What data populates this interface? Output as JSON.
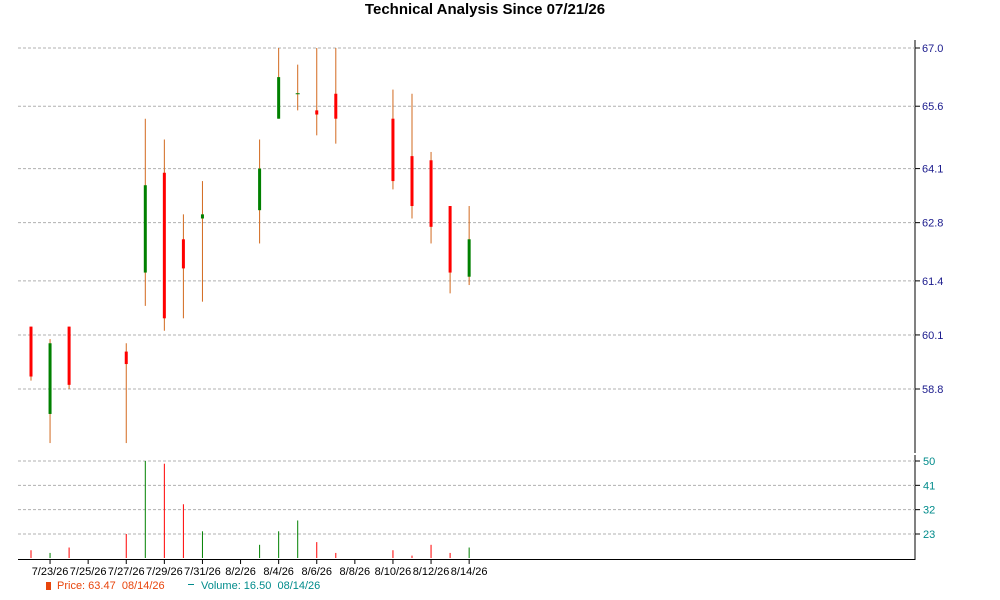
{
  "colors": {
    "up": "#008000",
    "down": "#ff0000",
    "wick": "#d2691e",
    "price_axis_text": "#1a1a8c",
    "volume_axis_text": "#008b8b",
    "grid": "#b0b0b0",
    "legend_price": "#e8450c",
    "legend_volume": "#008b8b"
  },
  "chart_data": {
    "type": "candlestick",
    "title": "Technical Analysis Since 07/21/26",
    "grid": true,
    "price_axis": {
      "position": "right",
      "ticks": [
        "67.0",
        "65.6",
        "64.1",
        "62.8",
        "61.4",
        "60.1",
        "58.8"
      ],
      "tick_values": [
        67.0,
        65.6,
        64.1,
        62.8,
        61.4,
        60.1,
        58.8
      ],
      "range": [
        57.4,
        67.0
      ]
    },
    "volume_axis": {
      "position": "right",
      "ticks": [
        "50",
        "41",
        "32",
        "23"
      ],
      "tick_values": [
        50,
        41,
        32,
        23
      ],
      "range": [
        15,
        50
      ]
    },
    "x_axis_labels": [
      "7/23/26",
      "7/25/26",
      "7/27/26",
      "7/29/26",
      "7/31/26",
      "8/2/26",
      "8/4/26",
      "8/6/26",
      "8/8/26",
      "8/10/26",
      "8/12/26",
      "8/14/26"
    ],
    "candles": [
      {
        "date": "7/22/26",
        "open": 60.3,
        "high": 60.3,
        "low": 59.0,
        "close": 59.1,
        "volume": 17
      },
      {
        "date": "7/23/26",
        "open": 58.2,
        "high": 60.0,
        "low": 57.5,
        "close": 59.9,
        "volume": 16
      },
      {
        "date": "7/24/26",
        "open": 60.3,
        "high": 60.3,
        "low": 58.8,
        "close": 58.9,
        "volume": 18
      },
      {
        "date": "7/27/26",
        "open": 59.7,
        "high": 59.9,
        "low": 57.5,
        "close": 59.4,
        "volume": 23
      },
      {
        "date": "7/28/26",
        "open": 61.6,
        "high": 65.3,
        "low": 60.8,
        "close": 63.7,
        "volume": 50
      },
      {
        "date": "7/29/26",
        "open": 64.0,
        "high": 64.8,
        "low": 60.2,
        "close": 60.5,
        "volume": 49
      },
      {
        "date": "7/30/26",
        "open": 62.4,
        "high": 63.0,
        "low": 60.5,
        "close": 61.7,
        "volume": 34
      },
      {
        "date": "7/31/26",
        "open": 62.9,
        "high": 63.8,
        "low": 60.9,
        "close": 63.0,
        "volume": 24
      },
      {
        "date": "8/3/26",
        "open": 63.1,
        "high": 64.8,
        "low": 62.3,
        "close": 64.1,
        "volume": 19
      },
      {
        "date": "8/4/26",
        "open": 65.3,
        "high": 67.0,
        "low": 65.3,
        "close": 66.3,
        "volume": 24
      },
      {
        "date": "8/5/26",
        "open": 65.9,
        "high": 66.6,
        "low": 65.5,
        "close": 65.9,
        "volume": 28
      },
      {
        "date": "8/6/26",
        "open": 65.5,
        "high": 67.0,
        "low": 64.9,
        "close": 65.4,
        "volume": 20
      },
      {
        "date": "8/7/26",
        "open": 65.9,
        "high": 67.0,
        "low": 64.7,
        "close": 65.3,
        "volume": 16
      },
      {
        "date": "8/10/26",
        "open": 65.3,
        "high": 66.0,
        "low": 63.6,
        "close": 63.8,
        "volume": 17
      },
      {
        "date": "8/11/26",
        "open": 64.4,
        "high": 65.9,
        "low": 62.9,
        "close": 63.2,
        "volume": 15
      },
      {
        "date": "8/12/26",
        "open": 64.3,
        "high": 64.5,
        "low": 62.3,
        "close": 62.7,
        "volume": 19
      },
      {
        "date": "8/13/26",
        "open": 63.2,
        "high": 63.2,
        "low": 61.1,
        "close": 61.6,
        "volume": 16
      },
      {
        "date": "8/14/26",
        "open": 61.5,
        "high": 63.2,
        "low": 61.3,
        "close": 62.4,
        "volume": 18
      }
    ]
  },
  "legend": {
    "price_label": "Price: 63.47",
    "price_date": "08/14/26",
    "volume_label": "Volume: 16.50",
    "volume_date": "08/14/26"
  }
}
